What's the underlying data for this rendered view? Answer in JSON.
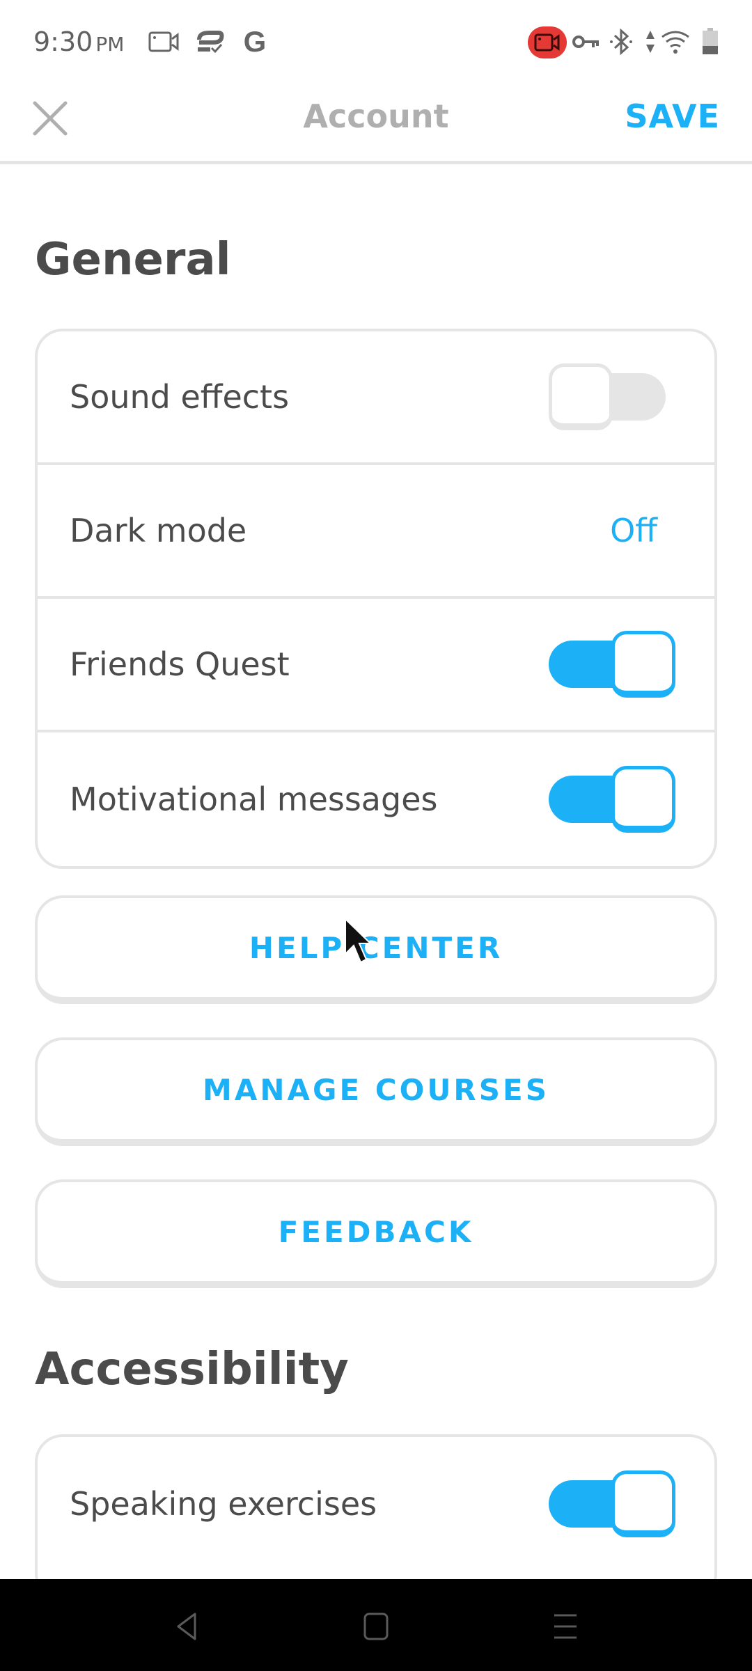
{
  "status_bar": {
    "time": "9:30",
    "ampm": "PM",
    "left_icons": [
      "screen-record-icon",
      "sync-check-icon",
      "google-icon"
    ],
    "right_icons": [
      "recording-camera-icon",
      "vpn-key-icon",
      "bluetooth-icon",
      "data-arrows-icon",
      "wifi-icon",
      "battery-icon"
    ],
    "recording_color": "#e53935"
  },
  "toolbar": {
    "close_icon": "close-icon",
    "title": "Account",
    "save_label": "SAVE"
  },
  "general": {
    "title": "General",
    "rows": [
      {
        "label": "Sound effects",
        "type": "toggle",
        "on": false
      },
      {
        "label": "Dark mode",
        "type": "value",
        "value": "Off"
      },
      {
        "label": "Friends Quest",
        "type": "toggle",
        "on": true
      },
      {
        "label": "Motivational messages",
        "type": "toggle",
        "on": true
      }
    ]
  },
  "buttons": {
    "help_center": "HELP CENTER",
    "manage_courses": "MANAGE COURSES",
    "feedback": "FEEDBACK"
  },
  "accessibility": {
    "title": "Accessibility",
    "rows": [
      {
        "label": "Speaking exercises",
        "type": "toggle",
        "on": true
      }
    ]
  },
  "nav_bar": {
    "icons": [
      "back-icon",
      "home-icon",
      "recents-icon"
    ]
  },
  "colors": {
    "accent": "#1cb0f6",
    "text": "#4b4b4b",
    "muted": "#afafaf",
    "border": "#e5e5e5"
  }
}
